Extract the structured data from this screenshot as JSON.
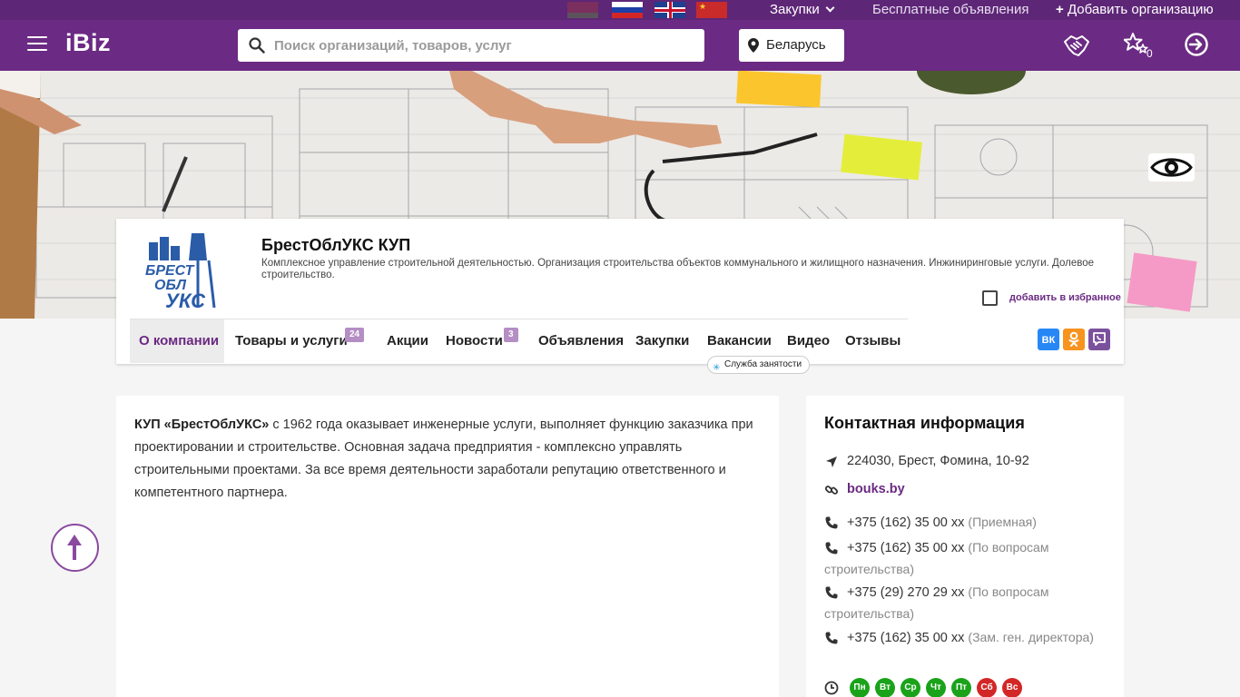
{
  "topbar": {
    "languages": [
      "Беларуская",
      "Русский",
      "English",
      "中文"
    ],
    "purchases_label": "Закупки",
    "free_ads_label": "Бесплатные объявления",
    "add_org_label": "Добавить организацию"
  },
  "header": {
    "logo": "iBiz",
    "search_placeholder": "Поиск организаций, товаров, услуг",
    "region": "Беларусь",
    "favorites_count": "0"
  },
  "company": {
    "name": "БрестОблУКС КУП",
    "description": "Комплексное управление строительной деятельностью. Организация строительства объектов коммунального и жилищного назначения. Инжиниринговые услуги. Долевое строительство.",
    "favorite_label": "добавить в избранное",
    "logo_text_line1": "БРЕСТ",
    "logo_text_line2": "ОБЛ",
    "logo_text_line3": "УКС"
  },
  "tabs": [
    {
      "label": "О компании",
      "badge": ""
    },
    {
      "label": "Товары и услуги",
      "badge": "24"
    },
    {
      "label": "Акции",
      "badge": ""
    },
    {
      "label": "Новости",
      "badge": "3"
    },
    {
      "label": "Объявления",
      "badge": ""
    },
    {
      "label": "Закупки",
      "badge": ""
    },
    {
      "label": "Вакансии",
      "badge": ""
    },
    {
      "label": "Видео",
      "badge": ""
    },
    {
      "label": "Отзывы",
      "badge": ""
    }
  ],
  "vacancies_tooltip": "Служба занятости",
  "social": {
    "vk": "VK",
    "ok": "OK",
    "viber": "Viber"
  },
  "about": {
    "company_bold": "КУП «БрестОблУКС»",
    "text": " с 1962 года оказывает инженерные услуги, выполняет функцию заказчика при проектировании и строительстве. Основная задача предприятия - комплексно управлять строительными проектами. За все время деятельности заработали репутацию ответственного и компетентного партнера."
  },
  "contacts": {
    "title": "Контактная информация",
    "address": "224030, Брест, Фомина, 10-92",
    "website": "bouks.by",
    "phones": [
      {
        "number": "+375 (162) 35 00 xx",
        "note": "(Приемная)"
      },
      {
        "number": "+375 (162) 35 00 xx",
        "note": "(По вопросам строительства)"
      },
      {
        "number": "+375 (29) 270 29 xx",
        "note": "(По вопросам строительства)"
      },
      {
        "number": "+375 (162) 35 00 xx",
        "note": "(Зам. ген. директора)"
      }
    ],
    "days": [
      {
        "label": "Пн",
        "open": true
      },
      {
        "label": "Вт",
        "open": true
      },
      {
        "label": "Ср",
        "open": true
      },
      {
        "label": "Чт",
        "open": true
      },
      {
        "label": "Пт",
        "open": true
      },
      {
        "label": "Сб",
        "open": false
      },
      {
        "label": "Вс",
        "open": false
      }
    ]
  },
  "colors": {
    "brand": "#6b2a83",
    "open_day": "#1aa31a",
    "closed_day": "#d32727"
  }
}
